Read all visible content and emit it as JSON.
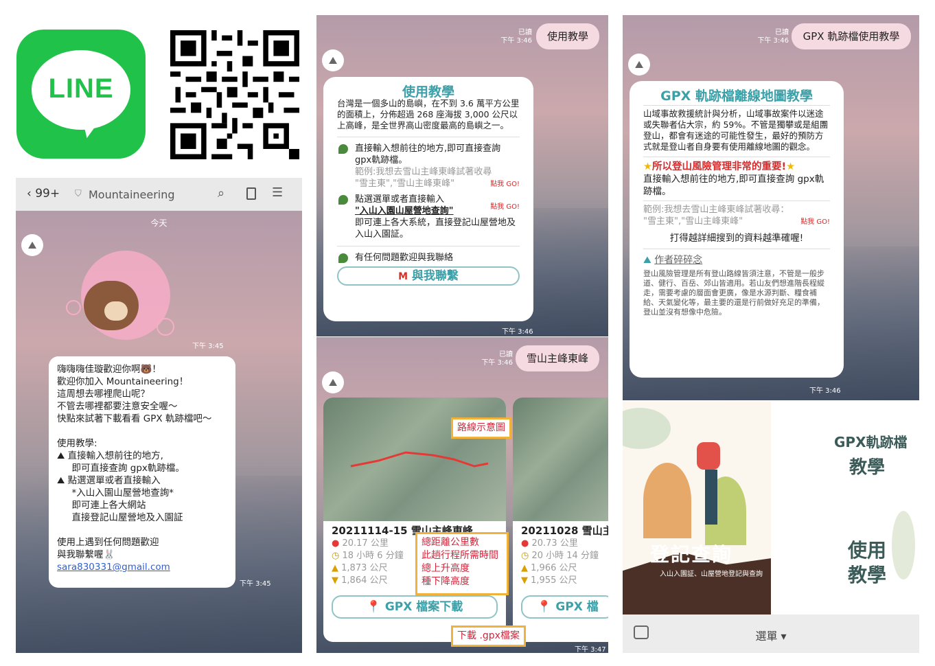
{
  "line_logo": {
    "text": "LINE",
    "color": "#21c24a"
  },
  "chat1": {
    "header": {
      "back": "99+",
      "title": "Mountaineering"
    },
    "date": "今天",
    "sticker_time": "下午 3:45",
    "message": {
      "lines": [
        "嗨嗨嗨佳璇歡迎你啊🐻！",
        "歡迎你加入 Mountaineering！",
        "這周想去哪裡爬山呢？",
        "不管去哪裡都要注意安全喔～",
        "快點來試著下載看看 GPX 軌跡檔吧～",
        "",
        "使用教學:",
        "⛰ 直接輸入想前往的地方,",
        "     即可直接查詢 gpx軌跡檔。",
        "⛰ 點選選單或者直接輸入",
        "     *入山入園山屋營地查詢*",
        "     即可連上各大網站",
        "     直接登記山屋營地及入園証",
        "",
        "使用上遇到任何問題歡迎",
        "與我聯繫喔🐰"
      ],
      "email": "sara830331@gmail.com",
      "time": "下午 3:45"
    }
  },
  "chat2": {
    "read": "已讀",
    "read_time": "下午 3:46",
    "sent": "使用教學",
    "card": {
      "title": "使用教學",
      "intro": "台灣是一個多山的島嶼，在不到 3.6 萬平方公里的面積上，分佈超過 268 座海拔 3,000 公尺以上高峰，是全世界高山密度最高的島嶼之一。",
      "item1": "直接輸入想前往的地方,即可直接查詢 gpx軌跡檔。",
      "example1": "範例:我想去雪山主峰東峰試著收尋",
      "example2": "\"雪主東\",\"雪山主峰東峰\"",
      "goto": "點我 GO!",
      "item2a": "點選選單或者直接輸入",
      "item2b": "\"入山入園山屋營地查詢\"",
      "item2c": "即可連上各大系統，直接登記山屋營地及入山入園証。",
      "item3": "有任何問題歡迎與我聯絡",
      "contact_btn": "與我聯繫"
    },
    "card_time": "下午 3:46"
  },
  "chat3": {
    "read": "已讀",
    "read_time": "下午 3:46",
    "sent": "雪山主峰東峰",
    "route1": {
      "title": "20211114-15 雪山主峰東峰",
      "distance": "20.17 公里",
      "duration": "18 小時 6 分鐘",
      "ascent": "1,873 公尺",
      "descent": "1,864 公尺",
      "button": "GPX 檔案下載"
    },
    "route2": {
      "title": "20211028 雪山主",
      "distance": "20.73 公里",
      "duration": "20 小時 14 分鐘",
      "ascent": "1,966 公尺",
      "descent": "1,955 公尺",
      "button": "GPX 檔"
    },
    "annotations": {
      "map": "路線示意圖",
      "stats": [
        "總距離公里數",
        "此趟行程所需時間",
        "總上升高度",
        "種下降高度"
      ],
      "download": "下載 .gpx檔案"
    },
    "time": "下午 3:47"
  },
  "chat4": {
    "read": "已讀",
    "read_time": "下午 3:46",
    "sent": "GPX 軌跡檔使用教學",
    "card": {
      "title": "GPX 軌跡檔離線地圖教學",
      "intro": "山域事故救援統計與分析，山域事故案件以迷途或失聯者佔大宗，約 59%。不管是獨攀或是組團登山，都會有迷途的可能性發生，最好的預防方式就是登山者自身要有使用離線地圖的觀念。",
      "emphasis": "所以登山風險管理非常的重要!",
      "line1": "直接輸入想前往的地方,即可直接查詢 gpx軌跡檔。",
      "example1": "範例:我想去雪山主峰東峰試著收尋：",
      "example2": "\"雪主東\",\"雪山主峰東峰\"",
      "goto": "點我 GO!",
      "tip": "打得越詳細搜到的資料越準確喔!",
      "note_title": "作者碎碎念",
      "note": "登山風險管理是所有登山路線皆須注意，不管是一般步道、健行、百岳、郊山皆適用。若山友們想進階長程縱走，需要考慮的層面會更廣，像是水源判斷、糧食補給、天氣變化等，最主要的還是行前做好充足的準備，登山並沒有想像中危險。"
    },
    "time": "下午 3:46"
  },
  "menu": {
    "left_text": "登記查詢",
    "left_sub": "入山入園証、山屋營地登記與查詢",
    "gpx": "GPX軌跡檔",
    "teach": "教學",
    "use1": "使用",
    "use2": "教學",
    "footer": "選單 ▾"
  }
}
